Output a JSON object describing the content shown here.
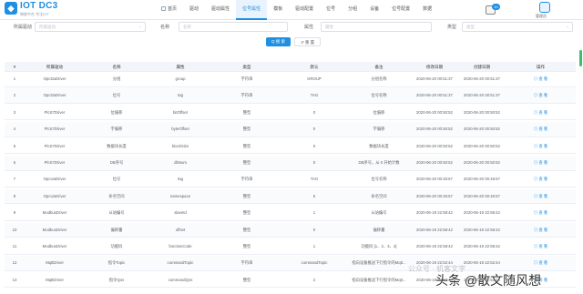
{
  "brand": {
    "title": "IOT DC3",
    "subtitle": "物联中台  专注IOT"
  },
  "nav": {
    "items": [
      "首页",
      "驱动",
      "驱动属性",
      "位号属性",
      "模板",
      "驱动配置",
      "位号",
      "分组",
      "设备",
      "位号配置",
      "数据"
    ],
    "active_index": 3
  },
  "notifications": {
    "count": "10"
  },
  "user": {
    "name": "管理员"
  },
  "filters": {
    "driver_label": "所属驱动",
    "driver_placeholder": "所属驱动",
    "name_label": "名称",
    "name_placeholder": "名称",
    "attr_label": "属性",
    "attr_placeholder": "属性",
    "type_label": "类型",
    "type_placeholder": "类型"
  },
  "buttons": {
    "search": "Q 搜 索",
    "reset": "↺ 重 置"
  },
  "table": {
    "headers": [
      "#",
      "所属驱动",
      "名称",
      "属性",
      "类型",
      "默认",
      "备注",
      "修改日期",
      "创建日期",
      "操作"
    ],
    "rows": [
      [
        "1",
        "OpcDaDriver",
        "分组",
        "group",
        "字符串",
        "GROUP",
        "分组名称",
        "2020-06-20 00:51:37",
        "2020-06-20 00:51:37",
        "◎ 查 看"
      ],
      [
        "2",
        "OpcDaDriver",
        "位号",
        "tag",
        "字符串",
        "TAG",
        "位号名称",
        "2020-06-20 00:51:37",
        "2020-06-20 00:51:37",
        "◎ 查 看"
      ],
      [
        "3",
        "PlcS7Driver",
        "位偏移",
        "bitOffset",
        "整型",
        "0",
        "位偏移",
        "2020-06-20 00:50:52",
        "2020-06-20 00:50:52",
        "◎ 查 看"
      ],
      [
        "4",
        "PlcS7Driver",
        "字偏移",
        "byteOffset",
        "整型",
        "0",
        "字偏移",
        "2020-06-20 00:50:52",
        "2020-06-20 00:50:52",
        "◎ 查 看"
      ],
      [
        "5",
        "PlcS7Driver",
        "数据块长度",
        "blockSize",
        "整型",
        "0",
        "数据块长度",
        "2020-06-20 00:50:52",
        "2020-06-20 00:50:52",
        "◎ 查 看"
      ],
      [
        "6",
        "PlcS7Driver",
        "DB序号",
        "dbNum",
        "整型",
        "0",
        "DB序号，从 0 开始计数",
        "2020-06-20 00:50:52",
        "2020-06-20 00:50:52",
        "◎ 查 看"
      ],
      [
        "7",
        "OpcUaDriver",
        "位号",
        "tag",
        "字符串",
        "TAG",
        "位号名称",
        "2020-06-20 00:45:57",
        "2020-06-20 00:45:57",
        "◎ 查 看"
      ],
      [
        "8",
        "OpcUaDriver",
        "命名空间",
        "namespace",
        "整型",
        "5",
        "命名空间",
        "2020-06-20 00:45:57",
        "2020-06-20 00:45:57",
        "◎ 查 看"
      ],
      [
        "9",
        "ModbusDriver",
        "从站编号",
        "slaveId",
        "整型",
        "1",
        "从站编号",
        "2020-06-19 22:58:42",
        "2020-06-19 22:58:42",
        "◎ 查 看"
      ],
      [
        "10",
        "ModbusDriver",
        "偏移量",
        "offset",
        "整型",
        "0",
        "偏移量",
        "2020-06-19 22:58:42",
        "2020-06-19 22:58:42",
        "◎ 查 看"
      ],
      [
        "11",
        "ModbusDriver",
        "功能码",
        "functionCode",
        "整型",
        "1",
        "功能码 [1、2、3、4]",
        "2020-06-19 22:58:42",
        "2020-06-19 22:58:42",
        "◎ 查 看"
      ],
      [
        "12",
        "MqttDriver",
        "指令Topic",
        "commandTopic",
        "字符串",
        "commandTopic",
        "指向设备推送下行指令的Mqtt...",
        "2020-06-19 22:52:44",
        "2020-06-19 22:52:44",
        "◎ 查 看"
      ],
      [
        "13",
        "MqttDriver",
        "指令Qos",
        "commandQos",
        "整型",
        "2",
        "指向设备推送下行指令的Mqtt...",
        "2020-06-19 22:52:44",
        "2020-06-19 22:52:44",
        "◎ 查 看"
      ]
    ]
  },
  "watermark": {
    "top": "公众号 · 机客文字",
    "main": "头条 @散文随风想"
  },
  "colors": {
    "accent": "#1e8fe1",
    "scrollbar": "#39c06a"
  }
}
